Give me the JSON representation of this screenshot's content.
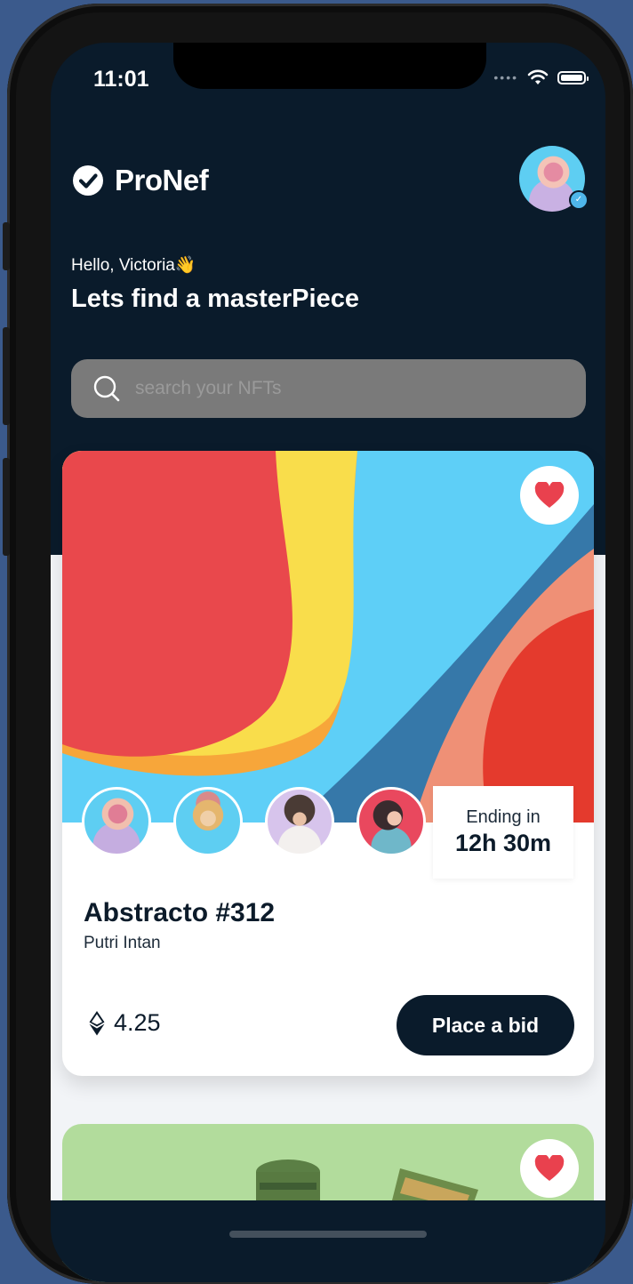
{
  "status_bar": {
    "time": "11:01"
  },
  "brand": {
    "name": "ProNef"
  },
  "greeting": {
    "hello": "Hello, Victoria",
    "emoji": "👋",
    "headline": "Lets find a masterPiece"
  },
  "search": {
    "placeholder": "search your NFTs"
  },
  "featured_card": {
    "title": "Abstracto #312",
    "artist": "Putri Intan",
    "ending_label": "Ending in",
    "ending_value": "12h 30m",
    "price": "4.25",
    "bid_label": "Place a bid",
    "bidder_count": 4
  },
  "colors": {
    "dark_bg": "#0a1b2b",
    "heart": "#e9414e",
    "art_red": "#e9484c",
    "art_yellow": "#f9dd4b",
    "art_sky": "#5ecff7",
    "art_blue": "#3678a9",
    "art_salmon": "#ef9076",
    "art_deep_red": "#e43a2d",
    "card2_green": "#b2dc9c"
  },
  "icons": [
    "check-circle-icon",
    "wifi-icon",
    "battery-icon",
    "search-icon",
    "heart-icon",
    "ethereum-icon",
    "verified-badge-icon"
  ]
}
